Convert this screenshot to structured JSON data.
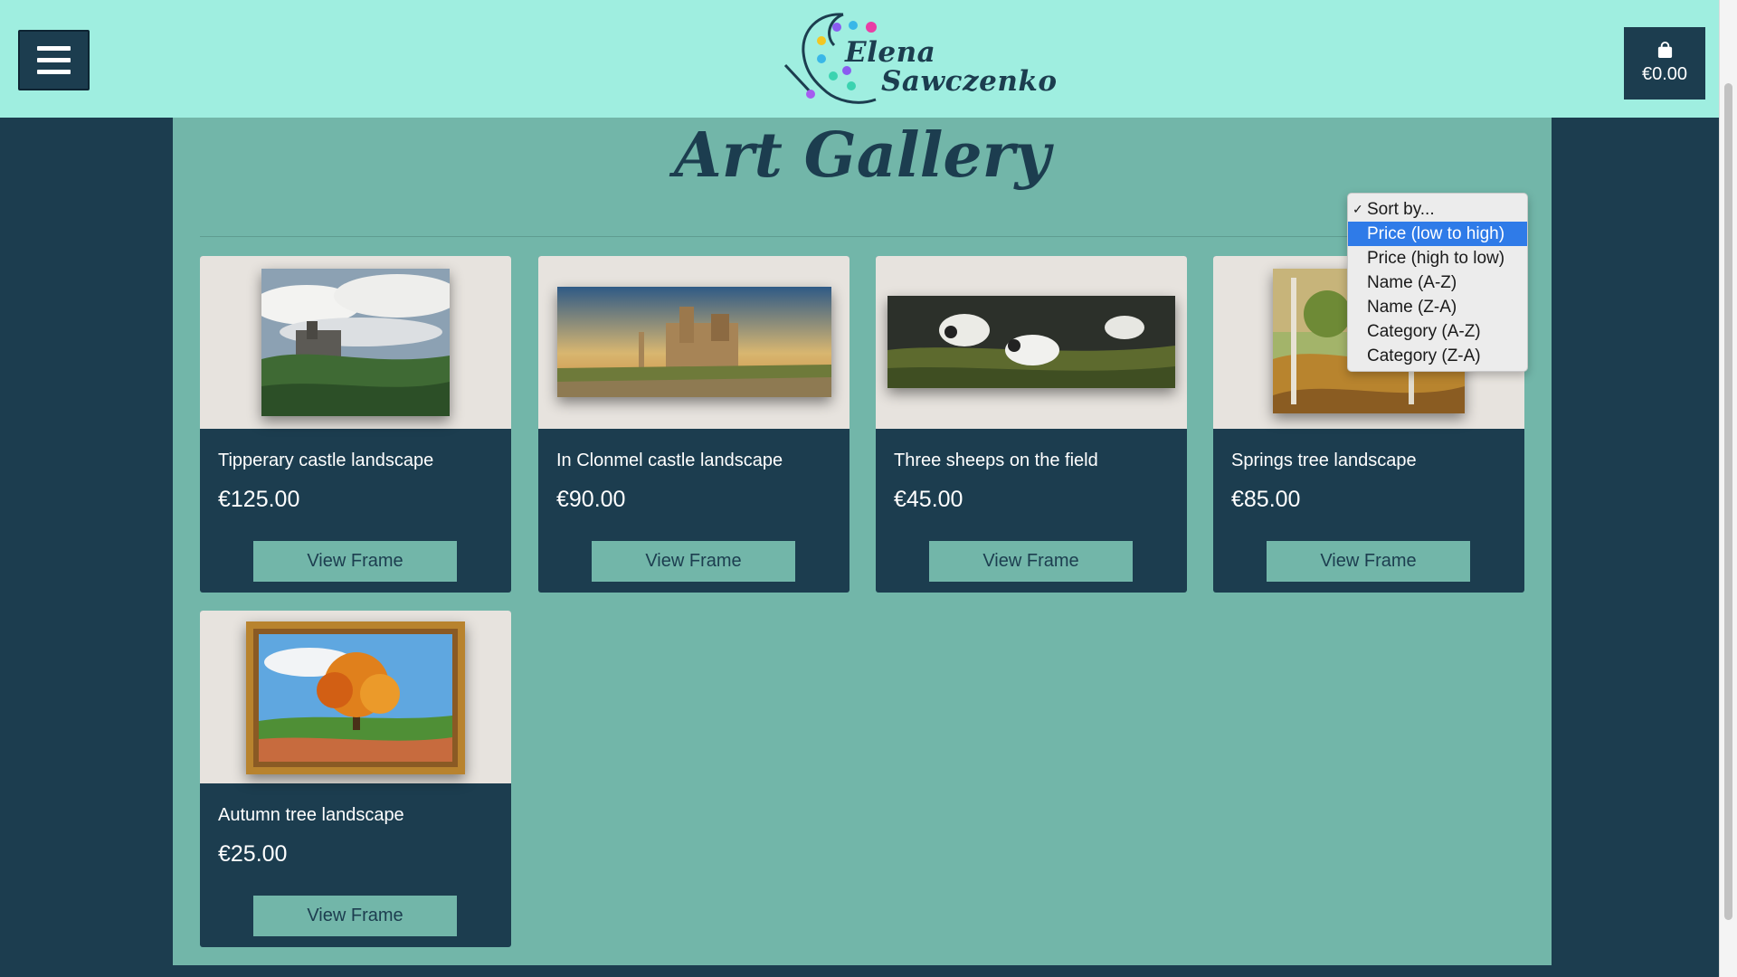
{
  "header": {
    "logo_line1": "Elena",
    "logo_line2": "Sawczenko",
    "cart_total": "€0.00"
  },
  "main": {
    "title": "Art Gallery"
  },
  "sort": {
    "options": [
      {
        "label": "Sort by...",
        "checked": true
      },
      {
        "label": "Price (low to high)",
        "highlighted": true
      },
      {
        "label": "Price (high to low)"
      },
      {
        "label": "Name (A-Z)"
      },
      {
        "label": "Name (Z-A)"
      },
      {
        "label": "Category (A-Z)"
      },
      {
        "label": "Category (Z-A)"
      }
    ]
  },
  "products": [
    {
      "name": "Tipperary castle landscape",
      "price": "€125.00",
      "button": "View Frame"
    },
    {
      "name": "In Clonmel castle landscape",
      "price": "€90.00",
      "button": "View Frame"
    },
    {
      "name": "Three sheeps on the field",
      "price": "€45.00",
      "button": "View Frame"
    },
    {
      "name": "Springs tree landscape",
      "price": "€85.00",
      "button": "View Frame"
    },
    {
      "name": "Autumn tree landscape",
      "price": "€25.00",
      "button": "View Frame"
    }
  ],
  "colors": {
    "header_bg": "#9feee0",
    "page_bg": "#1c3d4f",
    "content_bg": "#72b6a9",
    "accent": "#2f7be8"
  }
}
